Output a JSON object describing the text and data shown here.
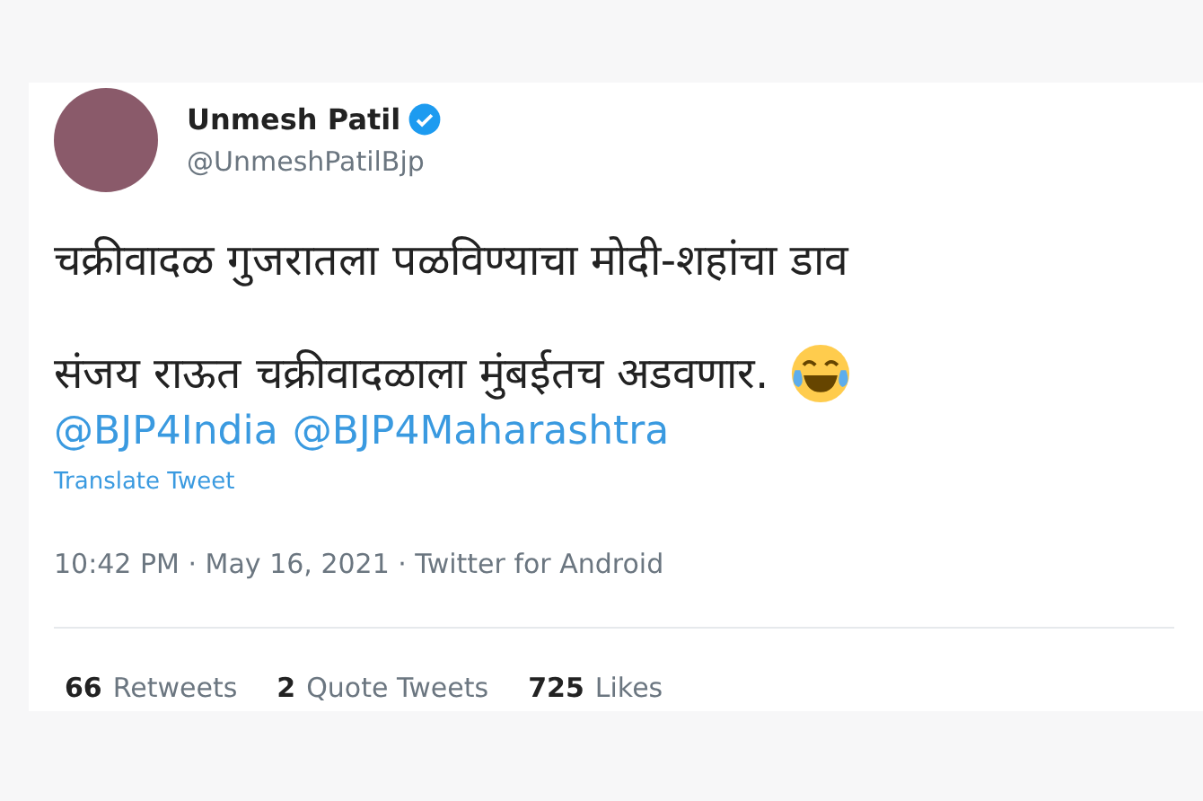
{
  "author": {
    "name": "Unmesh Patil",
    "verified": true,
    "handle": "@UnmeshPatilBjp"
  },
  "tweet": {
    "lines": [
      "चक्रीवादळ गुजरातला पळविण्याचा मोदी-शहांचा डाव",
      "संजय राऊत चक्रीवादळाला मुंबईतच अडवणार."
    ],
    "mentions": [
      "@BJP4India",
      "@BJP4Maharashtra"
    ],
    "translate": "Translate Tweet"
  },
  "meta": "10:42 PM · May 16, 2021 · Twitter for Android",
  "stats": [
    {
      "count": "66",
      "label": "Retweets"
    },
    {
      "count": "2",
      "label": "Quote Tweets"
    },
    {
      "count": "725",
      "label": "Likes"
    }
  ]
}
